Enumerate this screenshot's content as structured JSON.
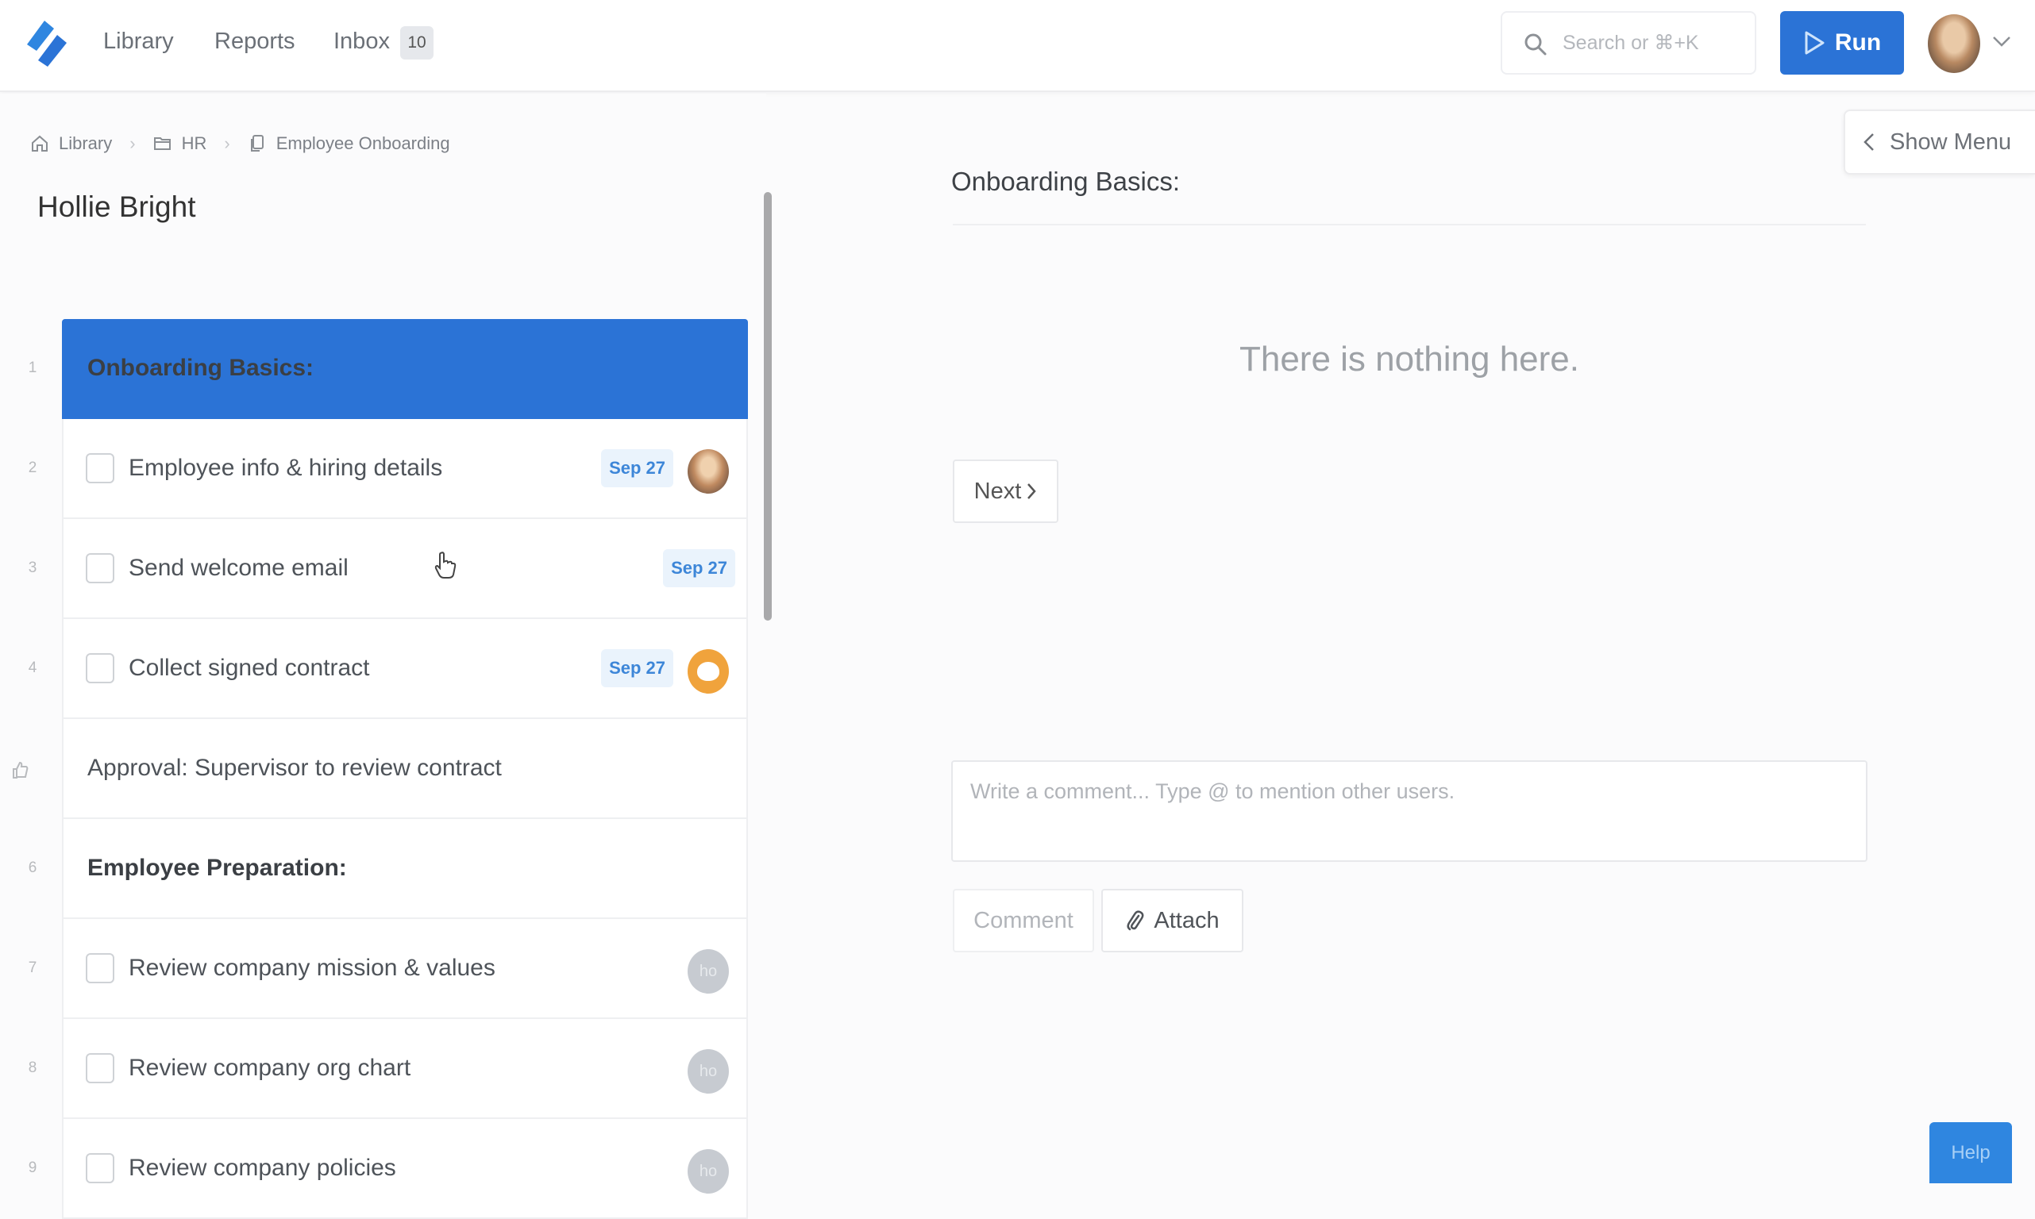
{
  "topnav": {
    "logo": "app-logo",
    "items": [
      {
        "label": "Library"
      },
      {
        "label": "Reports"
      },
      {
        "label": "Inbox",
        "badge": "10"
      }
    ],
    "search": {
      "placeholder": "Search or ⌘+K",
      "value": ""
    },
    "run_label": "Run",
    "user_avatar": "user-avatar-photo"
  },
  "breadcrumb": {
    "items": [
      {
        "icon": "home-icon",
        "label": "Library"
      },
      {
        "icon": "folder-icon",
        "label": "HR"
      },
      {
        "icon": "document-icon",
        "label": "Employee Onboarding"
      }
    ]
  },
  "person_title": "Hollie Bright",
  "steps": [
    {
      "number": "1",
      "title": "Onboarding Basics:",
      "type": "heading",
      "active": true
    },
    {
      "number": "2",
      "title": "Employee info & hiring details",
      "type": "task",
      "checked": false,
      "due": "Sep 27",
      "assignee": "photo"
    },
    {
      "number": "3",
      "title": "Send welcome email",
      "type": "task",
      "checked": false,
      "due": "Sep 27"
    },
    {
      "number": "4",
      "title": "Collect signed contract",
      "type": "task",
      "checked": false,
      "due": "Sep 27",
      "assignee": "orange-avatar"
    },
    {
      "number": "",
      "icon": "thumbs-up-icon",
      "title": "Approval: Supervisor to review contract",
      "type": "approval"
    },
    {
      "number": "6",
      "title": "Employee Preparation:",
      "type": "heading"
    },
    {
      "number": "7",
      "title": "Review company mission & values",
      "type": "task",
      "checked": false,
      "assignee_initials": "ho"
    },
    {
      "number": "8",
      "title": "Review company org chart",
      "type": "task",
      "checked": false,
      "assignee_initials": "ho"
    },
    {
      "number": "9",
      "title": "Review company policies",
      "type": "task",
      "checked": false,
      "assignee_initials": "ho"
    }
  ],
  "detail": {
    "show_menu_label": "Show Menu",
    "section_title": "Onboarding Basics:",
    "empty_message": "There is nothing here.",
    "next_label": "Next",
    "comment_placeholder": "Write a comment... Type @ to mention other users.",
    "comment_value": "",
    "comment_button": "Comment",
    "attach_button": "Attach"
  },
  "help_label": "Help",
  "colors": {
    "accent": "#2b73d6",
    "due_badge_text": "#3d86d8",
    "due_badge_bg": "#eaf3fc",
    "help_bg": "#2f86e0"
  }
}
